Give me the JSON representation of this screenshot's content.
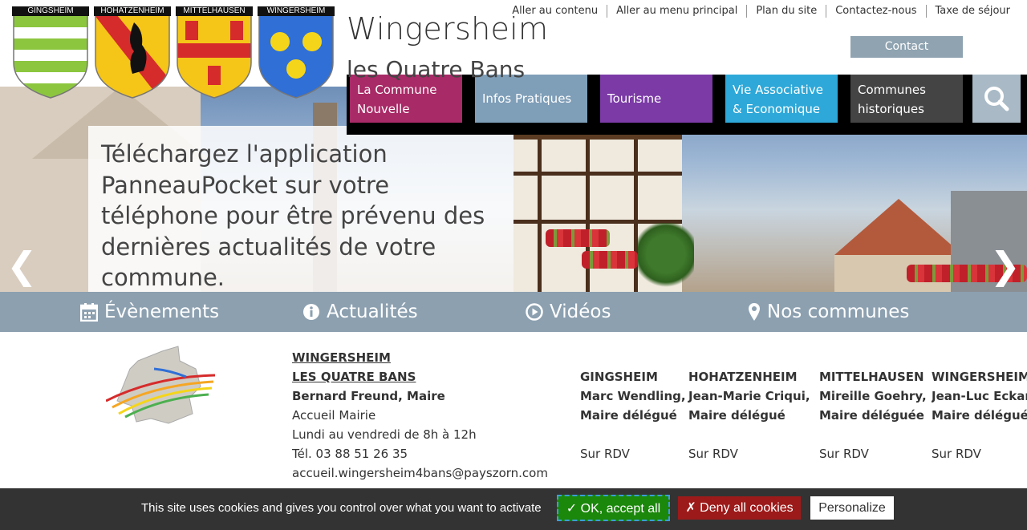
{
  "header": {
    "shields": [
      {
        "label": "GINGSHEIM"
      },
      {
        "label": "HOHATZENHEIM"
      },
      {
        "label": "MITTELHAUSEN"
      },
      {
        "label": "WINGERSHEIM"
      }
    ],
    "title": "Wingersheim",
    "subtitle": "les Quatre Bans",
    "toplinks": [
      "Aller au contenu",
      "Aller au menu principal",
      "Plan du site",
      "Contactez-nous",
      "Taxe de séjour"
    ],
    "contact_label": "Contact"
  },
  "nav": {
    "items": [
      {
        "label": "La Commune Nouvelle",
        "color": "#a82a66"
      },
      {
        "label": "Infos Pratiques",
        "color": "#7f9eb8"
      },
      {
        "label": "Tourisme",
        "color": "#7b3aa6"
      },
      {
        "label": "Vie Associative & Economique",
        "color": "#2ea8d8"
      },
      {
        "label": "Communes historiques",
        "color": "#444444"
      }
    ],
    "search_icon": "search-icon"
  },
  "hero": {
    "text": "Téléchargez l'application PanneauPocket sur votre téléphone pour être prévenu des dernières actualités de votre commune.",
    "prev": "❮",
    "next": "❯"
  },
  "quicklinks": [
    {
      "label": "Évènements",
      "icon": "calendar-icon"
    },
    {
      "label": "Actualités",
      "icon": "info-icon"
    },
    {
      "label": "Vidéos",
      "icon": "play-icon"
    },
    {
      "label": "Nos communes",
      "icon": "map-marker-icon"
    }
  ],
  "info": {
    "main": {
      "name_line1": "WINGERSHEIM",
      "name_line2": "LES QUATRE BANS",
      "mayor": "Bernard Freund, Maire",
      "accueil": "Accueil Mairie",
      "hours": "Lundi au vendredi de 8h à 12h",
      "phone": "Tél. 03 88 51 26 35",
      "email": "accueil.wingersheim4bans@payszorn.com"
    },
    "communes": [
      {
        "name": "GINGSHEIM",
        "mayor": "Marc Wendling,",
        "role": "Maire délégué",
        "rdv": "Sur RDV"
      },
      {
        "name": "HOHATZENHEIM",
        "mayor": "Jean-Marie Criqui,",
        "role": "Maire délégué",
        "rdv": "Sur RDV"
      },
      {
        "name": "MITTELHAUSEN",
        "mayor": "Mireille Goehry,",
        "role": "Maire déléguée",
        "rdv": "Sur RDV"
      },
      {
        "name": "WINGERSHEIM",
        "mayor": "Jean-Luc Eckart,",
        "role": "Maire délégué",
        "rdv": "Sur RDV"
      }
    ]
  },
  "cookie": {
    "text": "This site uses cookies and gives you control over what you want to activate",
    "accept": "✓ OK, accept all",
    "deny": "✗ Deny all cookies",
    "personalize": "Personalize"
  }
}
